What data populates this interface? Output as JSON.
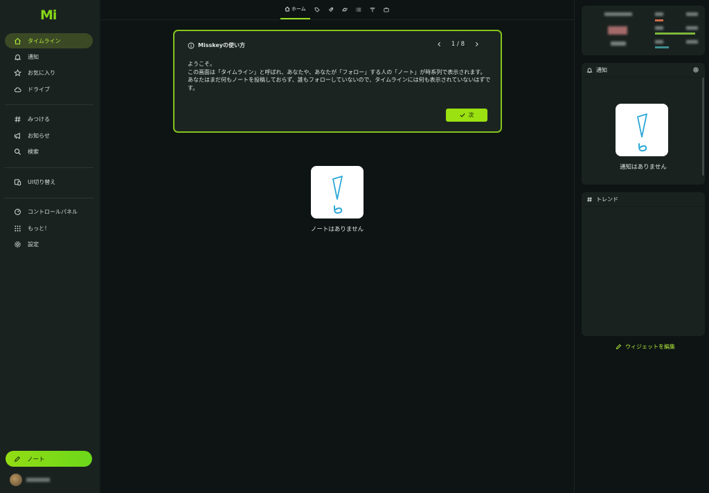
{
  "app": {
    "logo": "Mi"
  },
  "sidebar": {
    "items": [
      {
        "label": "タイムライン",
        "icon": "home-icon",
        "active": true
      },
      {
        "label": "通知",
        "icon": "bell-icon"
      },
      {
        "label": "お気に入り",
        "icon": "star-icon"
      },
      {
        "label": "ドライブ",
        "icon": "cloud-icon"
      },
      {
        "label": "みつける",
        "icon": "hash-icon"
      },
      {
        "label": "お知らせ",
        "icon": "speaker-icon"
      },
      {
        "label": "検索",
        "icon": "search-icon"
      },
      {
        "label": "UI切り替え",
        "icon": "devices-icon"
      },
      {
        "label": "コントロールパネル",
        "icon": "gauge-icon"
      },
      {
        "label": "もっと！",
        "icon": "grid-icon"
      },
      {
        "label": "設定",
        "icon": "gear-icon"
      }
    ],
    "note_button": "ノート"
  },
  "tabs": [
    {
      "label": "ホーム",
      "icon": "home-icon",
      "active": true
    },
    {
      "label": "",
      "icon": "tag-icon"
    },
    {
      "label": "",
      "icon": "rocket-icon"
    },
    {
      "label": "",
      "icon": "planet-icon"
    },
    {
      "label": "",
      "icon": "list-icon"
    },
    {
      "label": "",
      "icon": "antenna-icon"
    },
    {
      "label": "",
      "icon": "tv-icon"
    }
  ],
  "tutorial": {
    "title": "Misskeyの使い方",
    "pager": "1 / 8",
    "line1": "ようこそ。",
    "line2": "この画面は「タイムライン」と呼ばれ、あなたや、あなたが「フォロー」する人の「ノート」が時系列で表示されます。",
    "line3": "あなたはまだ何もノートを投稿しておらず、誰もフォローしていないので、タイムラインには何も表示されていないはずです。",
    "next_button": "次"
  },
  "timeline": {
    "empty_text": "ノートはありません"
  },
  "widgets": {
    "notifications": {
      "title": "通知",
      "empty_text": "通知はありません"
    },
    "trends": {
      "title": "トレンド"
    },
    "edit_label": "ウィジェットを編集"
  },
  "colors": {
    "accent": "#9be011",
    "background": "#0d1413",
    "panel": "#1a2220"
  }
}
